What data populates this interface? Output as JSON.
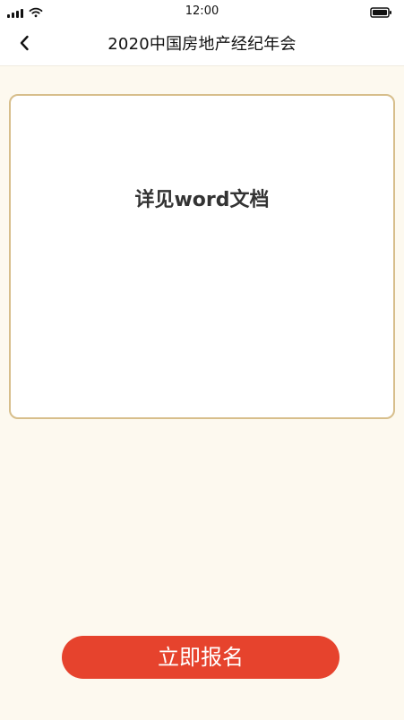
{
  "status_bar": {
    "time": "12:00",
    "signal_icon": "signal-icon",
    "wifi_icon": "wifi-icon",
    "battery_icon": "battery-icon"
  },
  "nav": {
    "title": "2020中国房地产经纪年会",
    "back_icon": "chevron-left-icon"
  },
  "card": {
    "text": "详见word文档"
  },
  "actions": {
    "signup_label": "立即报名"
  },
  "colors": {
    "background": "#fdf9ef",
    "card_border": "#d7be8b",
    "primary_button": "#e6432d"
  }
}
